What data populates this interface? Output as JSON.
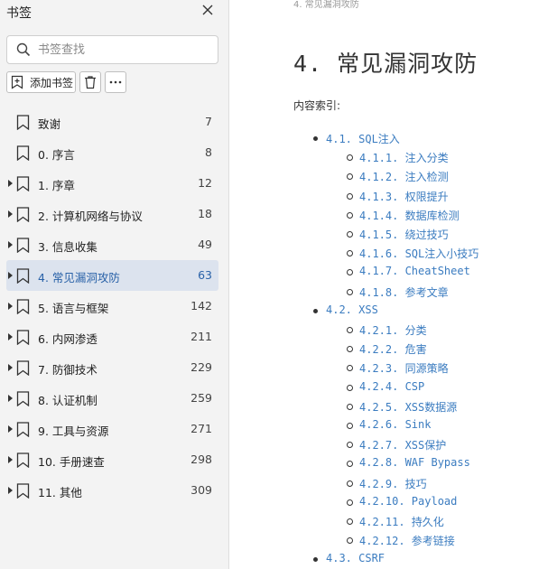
{
  "sidebar": {
    "title": "书签",
    "search_placeholder": "书签查找",
    "add_label": "添加书签",
    "items": [
      {
        "label": "致谢",
        "page": "7",
        "expandable": false,
        "active": false
      },
      {
        "label": "0. 序言",
        "page": "8",
        "expandable": false,
        "active": false
      },
      {
        "label": "1. 序章",
        "page": "12",
        "expandable": true,
        "active": false
      },
      {
        "label": "2. 计算机网络与协议",
        "page": "18",
        "expandable": true,
        "active": false
      },
      {
        "label": "3. 信息收集",
        "page": "49",
        "expandable": true,
        "active": false
      },
      {
        "label": "4. 常见漏洞攻防",
        "page": "63",
        "expandable": true,
        "active": true
      },
      {
        "label": "5. 语言与框架",
        "page": "142",
        "expandable": true,
        "active": false
      },
      {
        "label": "6. 内网渗透",
        "page": "211",
        "expandable": true,
        "active": false
      },
      {
        "label": "7. 防御技术",
        "page": "229",
        "expandable": true,
        "active": false
      },
      {
        "label": "8. 认证机制",
        "page": "259",
        "expandable": true,
        "active": false
      },
      {
        "label": "9. 工具与资源",
        "page": "271",
        "expandable": true,
        "active": false
      },
      {
        "label": "10. 手册速查",
        "page": "298",
        "expandable": true,
        "active": false
      },
      {
        "label": "11. 其他",
        "page": "309",
        "expandable": true,
        "active": false
      }
    ]
  },
  "document": {
    "running_head": "4. 常见漏洞攻防",
    "title": "4. 常见漏洞攻防",
    "toc_intro": "内容索引:",
    "toc": [
      {
        "level": 1,
        "text": "4.1. SQL注入"
      },
      {
        "level": 2,
        "text": "4.1.1. 注入分类"
      },
      {
        "level": 2,
        "text": "4.1.2. 注入检测"
      },
      {
        "level": 2,
        "text": "4.1.3. 权限提升"
      },
      {
        "level": 2,
        "text": "4.1.4. 数据库检测"
      },
      {
        "level": 2,
        "text": "4.1.5. 绕过技巧"
      },
      {
        "level": 2,
        "text": "4.1.6. SQL注入小技巧"
      },
      {
        "level": 2,
        "text": "4.1.7. CheatSheet"
      },
      {
        "level": 2,
        "text": "4.1.8. 参考文章"
      },
      {
        "level": 1,
        "text": "4.2. XSS"
      },
      {
        "level": 2,
        "text": "4.2.1. 分类"
      },
      {
        "level": 2,
        "text": "4.2.2. 危害"
      },
      {
        "level": 2,
        "text": "4.2.3. 同源策略"
      },
      {
        "level": 2,
        "text": "4.2.4. CSP"
      },
      {
        "level": 2,
        "text": "4.2.5. XSS数据源"
      },
      {
        "level": 2,
        "text": "4.2.6. Sink"
      },
      {
        "level": 2,
        "text": "4.2.7. XSS保护"
      },
      {
        "level": 2,
        "text": "4.2.8. WAF Bypass"
      },
      {
        "level": 2,
        "text": "4.2.9. 技巧"
      },
      {
        "level": 2,
        "text": "4.2.10. Payload"
      },
      {
        "level": 2,
        "text": "4.2.11. 持久化"
      },
      {
        "level": 2,
        "text": "4.2.12. 参考链接"
      },
      {
        "level": 1,
        "text": "4.3. CSRF"
      }
    ]
  },
  "colors": {
    "link": "#3b7cc0",
    "active_bg": "#dce3ee",
    "active_text": "#2a62a8",
    "sidebar_bg": "#f3f3f3"
  }
}
